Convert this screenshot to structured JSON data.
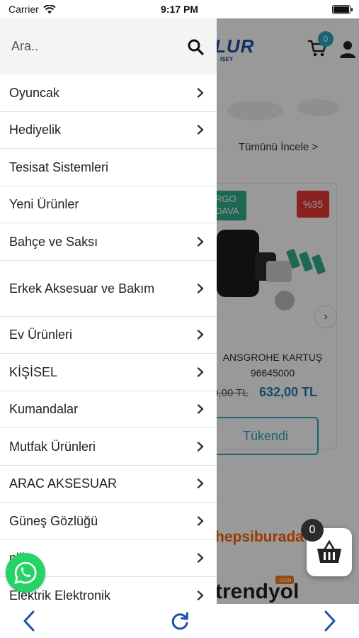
{
  "status_bar": {
    "carrier": "Carrier",
    "time": "9:17 PM",
    "battery_level": 1.0
  },
  "background_page": {
    "logo_text": "LUR",
    "logo_subtext": "IŞEY",
    "cart_count": "0",
    "see_all_link": "Tümünü İncele >",
    "product": {
      "badge_cargo": "RGO\nDAVA",
      "discount": "%35",
      "title": "ANSGROHE KARTUŞ\n96645000",
      "old_price": "0,00 TL",
      "new_price": "632,00 TL",
      "stock_button": "Tükendi"
    },
    "marketplace_1": "hepsiburada",
    "marketplace_2": "trendyol",
    "marketplace_2_domain": ".com"
  },
  "drawer": {
    "search_placeholder": "Ara..",
    "items": [
      {
        "label": "Oyuncak",
        "has_arrow": true
      },
      {
        "label": "Hediyelik",
        "has_arrow": true
      },
      {
        "label": "Tesisat Sistemleri",
        "has_arrow": false
      },
      {
        "label": "Yeni Ürünler",
        "has_arrow": false
      },
      {
        "label": "Bahçe ve Saksı",
        "has_arrow": true
      },
      {
        "label": "Erkek Aksesuar ve Bakım",
        "has_arrow": true
      },
      {
        "label": "Ev Ürünleri",
        "has_arrow": true
      },
      {
        "label": "KİŞİSEL",
        "has_arrow": true
      },
      {
        "label": "Kumandalar",
        "has_arrow": true
      },
      {
        "label": "Mutfak Ürünleri",
        "has_arrow": true
      },
      {
        "label": "ARAC AKSESUAR",
        "has_arrow": true
      },
      {
        "label": "Güneş Gözlüğü",
        "has_arrow": true
      },
      {
        "label": "nlik",
        "has_arrow": true
      },
      {
        "label": "Elektrik Elektronik",
        "has_arrow": true
      }
    ]
  },
  "floating_cart": {
    "count": "0"
  },
  "colors": {
    "accent": "#2aa7b9",
    "whatsapp": "#25d366",
    "nav": "#1f4fa8",
    "discount": "#e53935",
    "cargo": "#2fae8a"
  }
}
